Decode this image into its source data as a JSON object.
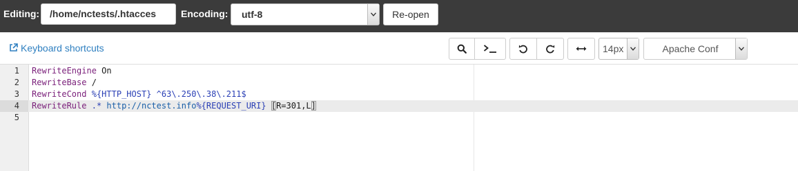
{
  "topbar": {
    "editing_label": "Editing:",
    "file_path": "/home/nctests/.htacces",
    "encoding_label": "Encoding:",
    "encoding_value": "utf-8",
    "reopen_label": "Re-open"
  },
  "toolbar": {
    "shortcuts_label": "Keyboard shortcuts",
    "font_size": "14px",
    "mode": "Apache Conf",
    "buttons": [
      "search-icon",
      "terminal-icon",
      "undo-icon",
      "redo-icon",
      "wrap-icon"
    ]
  },
  "editor": {
    "active_line": 4,
    "lines": [
      {
        "num": "1",
        "tokens": [
          [
            "kw",
            "RewriteEngine"
          ],
          [
            "txt",
            " On"
          ]
        ]
      },
      {
        "num": "2",
        "tokens": [
          [
            "kw",
            "RewriteBase"
          ],
          [
            "txt",
            " /"
          ]
        ]
      },
      {
        "num": "3",
        "tokens": [
          [
            "kw",
            "RewriteCond"
          ],
          [
            "txt",
            " "
          ],
          [
            "var",
            "%{HTTP_HOST}"
          ],
          [
            "txt",
            " "
          ],
          [
            "rx",
            "^63\\.250\\.38\\.211$"
          ]
        ]
      },
      {
        "num": "4",
        "tokens": [
          [
            "kw",
            "RewriteRule"
          ],
          [
            "txt",
            " "
          ],
          [
            "rx",
            ".*"
          ],
          [
            "txt",
            " "
          ],
          [
            "url",
            "http://nctest.info"
          ],
          [
            "var",
            "%{REQUEST_URI}"
          ],
          [
            "txt",
            " "
          ],
          [
            "brk",
            "["
          ],
          [
            "txt",
            "R=301,L"
          ],
          [
            "brk",
            "]"
          ]
        ]
      },
      {
        "num": "5",
        "tokens": []
      }
    ]
  },
  "colors": {
    "topbar_bg": "#3b3b3b",
    "link": "#2e7fc0",
    "keyword": "#7a1f7a",
    "variable": "#2a3fb5"
  }
}
